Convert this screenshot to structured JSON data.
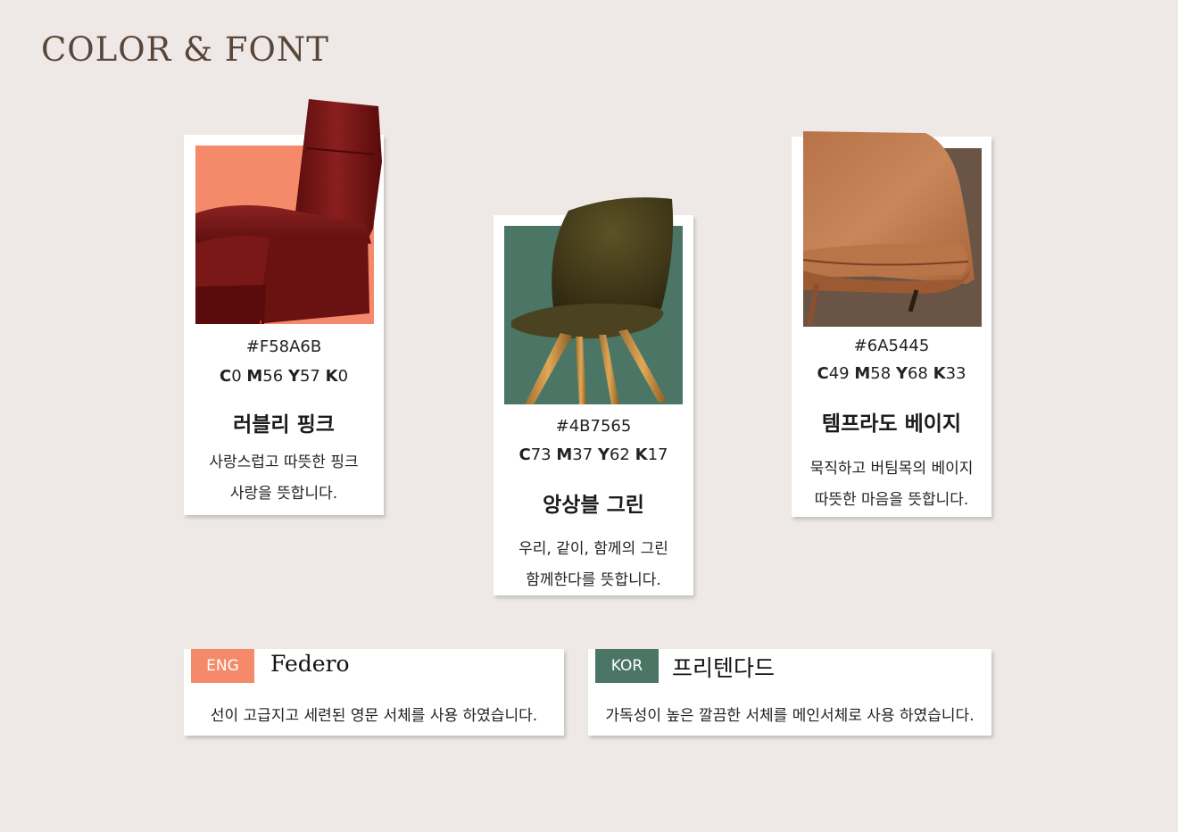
{
  "page": {
    "title": "COLOR & FONT"
  },
  "colors": [
    {
      "hex": "#F58A6B",
      "cmyk": [
        [
          "C",
          "0"
        ],
        [
          "M",
          "56"
        ],
        [
          "Y",
          "57"
        ],
        [
          "K",
          "0"
        ]
      ],
      "name": "러블리 핑크",
      "desc_line1": "사랑스럽고 따뜻한 핑크",
      "desc_line2": "사랑을 뜻합니다.",
      "swatch_color": "#F58A6B"
    },
    {
      "hex": "#4B7565",
      "cmyk": [
        [
          "C",
          "73"
        ],
        [
          "M",
          "37"
        ],
        [
          "Y",
          "62"
        ],
        [
          "K",
          "17"
        ]
      ],
      "name": "앙상블 그린",
      "desc_line1": "우리, 같이, 함께의 그린",
      "desc_line2": "함께한다를 뜻합니다.",
      "swatch_color": "#4B7565"
    },
    {
      "hex": "#6A5445",
      "cmyk": [
        [
          "C",
          "49"
        ],
        [
          "M",
          "58"
        ],
        [
          "Y",
          "68"
        ],
        [
          "K",
          "33"
        ]
      ],
      "name": "템프라도 베이지",
      "desc_line1": "묵직하고 버팀목의 베이지",
      "desc_line2": "따뜻한 마음을 뜻합니다.",
      "swatch_color": "#6A5445"
    }
  ],
  "fonts": [
    {
      "tag": "ENG",
      "tag_color": "#F58A6B",
      "name": "Federo",
      "desc": "선이 고급지고 세련된 영문 서체를 사용 하였습니다."
    },
    {
      "tag": "KOR",
      "tag_color": "#4B7565",
      "name": "프리텐다드",
      "desc": "가독성이 높은 깔끔한 서체를 메인서체로 사용 하였습니다."
    }
  ]
}
